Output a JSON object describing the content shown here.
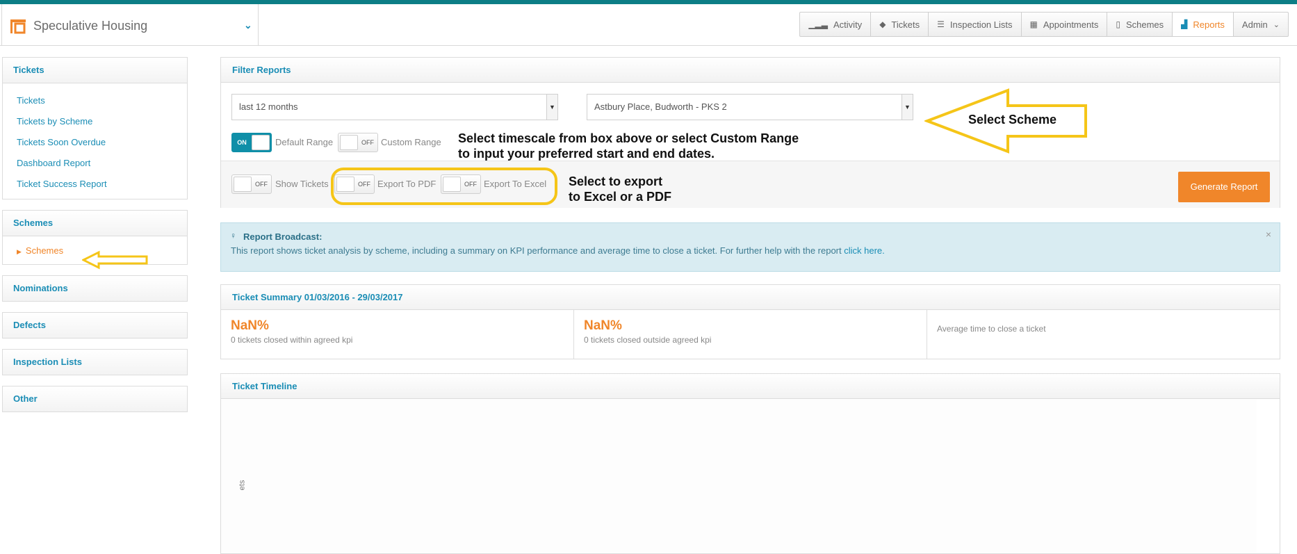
{
  "header": {
    "brand_name": "Speculative Housing",
    "nav": [
      {
        "label": "Activity",
        "icon": "signal-icon"
      },
      {
        "label": "Tickets",
        "icon": "tag-icon"
      },
      {
        "label": "Inspection Lists",
        "icon": "list-icon"
      },
      {
        "label": "Appointments",
        "icon": "calendar-icon"
      },
      {
        "label": "Schemes",
        "icon": "building-icon"
      },
      {
        "label": "Reports",
        "icon": "bar-chart-icon"
      }
    ],
    "admin_label": "Admin"
  },
  "sidebar": {
    "tickets": {
      "title": "Tickets",
      "links": [
        "Tickets",
        "Tickets by Scheme",
        "Tickets Soon Overdue",
        "Dashboard Report",
        "Ticket Success Report"
      ]
    },
    "schemes": {
      "title": "Schemes",
      "links": [
        "Schemes"
      ]
    },
    "nominations": "Nominations",
    "defects": "Defects",
    "inspection_lists": "Inspection Lists",
    "other": "Other"
  },
  "filter": {
    "title": "Filter Reports",
    "range_value": "last 12 months",
    "scheme_value": "Astbury Place, Budworth - PKS 2",
    "toggles": {
      "default_range": {
        "state": "ON",
        "label": "Default Range"
      },
      "custom_range": {
        "state": "OFF",
        "label": "Custom Range"
      },
      "show_tickets": {
        "state": "OFF",
        "label": "Show Tickets"
      },
      "export_pdf": {
        "state": "OFF",
        "label": "Export To PDF"
      },
      "export_excel": {
        "state": "OFF",
        "label": "Export To Excel"
      }
    },
    "generate_label": "Generate Report"
  },
  "annotations": {
    "select_scheme": "Select Scheme",
    "timescale_line1": "Select timescale from box above or select Custom Range",
    "timescale_line2": "to input your preferred start and end dates.",
    "export_line1": "Select to export",
    "export_line2": "to Excel or a PDF"
  },
  "broadcast": {
    "title": "Report Broadcast:",
    "text": "This report shows ticket analysis by scheme, including a summary on KPI performance and average time to close a ticket. For further help with the report ",
    "link": "click here.",
    "close": "×"
  },
  "summary": {
    "title": "Ticket Summary 01/03/2016 - 29/03/2017",
    "cells": [
      {
        "value": "NaN%",
        "desc": "0 tickets closed within agreed kpi"
      },
      {
        "value": "NaN%",
        "desc": "0 tickets closed outside agreed kpi"
      },
      {
        "value": "",
        "desc": "Average time to close a ticket"
      }
    ]
  },
  "timeline": {
    "title": "Ticket Timeline",
    "yaxis_fragment": "ets"
  },
  "colors": {
    "accent": "#1a8db5",
    "orange": "#f0862a",
    "annotation_yellow": "#f5c518"
  }
}
